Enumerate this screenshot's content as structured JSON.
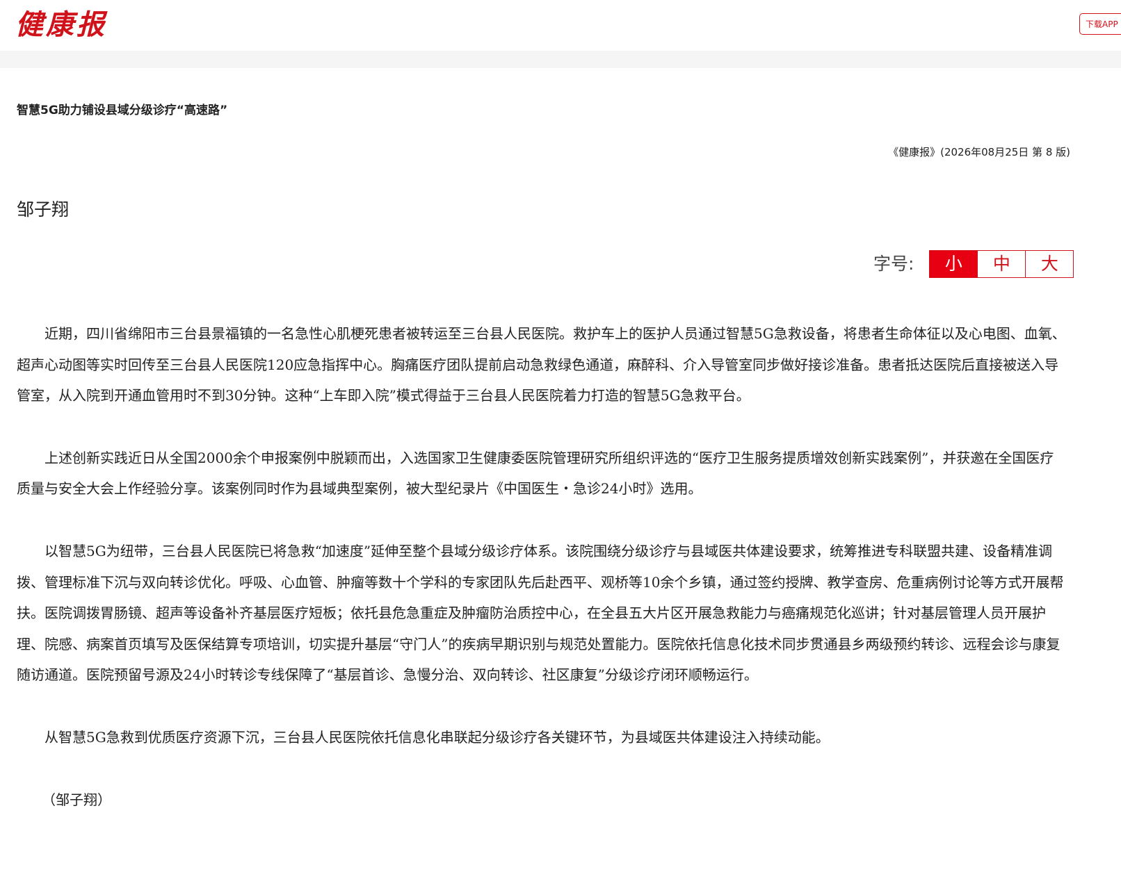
{
  "header": {
    "logo_text": "健康报",
    "download_app_label": "下载APP"
  },
  "article": {
    "title": "智慧5G助力铺设县域分级诊疗“高速路”",
    "source": "《健康报》(2026年08月25日 第 8 版)",
    "author": "邹子翔",
    "font_size_control": {
      "label": "字号:",
      "options": [
        "小",
        "中",
        "大"
      ],
      "selected": "小"
    },
    "paragraphs": [
      "近期，四川省绵阳市三台县景福镇的一名急性心肌梗死患者被转运至三台县人民医院。救护车上的医护人员通过智慧5G急救设备，将患者生命体征以及心电图、血氧、超声心动图等实时回传至三台县人民医院120应急指挥中心。胸痛医疗团队提前启动急救绿色通道，麻醉科、介入导管室同步做好接诊准备。患者抵达医院后直接被送入导管室，从入院到开通血管用时不到30分钟。这种“上车即入院”模式得益于三台县人民医院着力打造的智慧5G急救平台。",
      "上述创新实践近日从全国2000余个申报案例中脱颖而出，入选国家卫生健康委医院管理研究所组织评选的“医疗卫生服务提质增效创新实践案例”，并获邀在全国医疗质量与安全大会上作经验分享。该案例同时作为县域典型案例，被大型纪录片《中国医生・急诊24小时》选用。",
      "以智慧5G为纽带，三台县人民医院已将急救“加速度”延伸至整个县域分级诊疗体系。该院围绕分级诊疗与县域医共体建设要求，统筹推进专科联盟共建、设备精准调拨、管理标准下沉与双向转诊优化。呼吸、心血管、肿瘤等数十个学科的专家团队先后赴西平、观桥等10余个乡镇，通过签约授牌、教学查房、危重病例讨论等方式开展帮扶。医院调拨胃肠镜、超声等设备补齐基层医疗短板；依托县危急重症及肿瘤防治质控中心，在全县五大片区开展急救能力与癌痛规范化巡讲；针对基层管理人员开展护理、院感、病案首页填写及医保结算专项培训，切实提升基层“守门人”的疾病早期识别与规范处置能力。医院依托信息化技术同步贯通县乡两级预约转诊、远程会诊与康复随访通道。医院预留号源及24小时转诊专线保障了“基层首诊、急慢分治、双向转诊、社区康复”分级诊疗闭环顺畅运行。",
      "从智慧5G急救到优质医疗资源下沉，三台县人民医院依托信息化串联起分级诊疗各关键环节，为县域医共体建设注入持续动能。"
    ],
    "signature": "（邹子翔）"
  },
  "colors": {
    "brand_red": "#d0121b",
    "active_button_bg": "#e60012",
    "band_gray": "#f5f5f5"
  }
}
